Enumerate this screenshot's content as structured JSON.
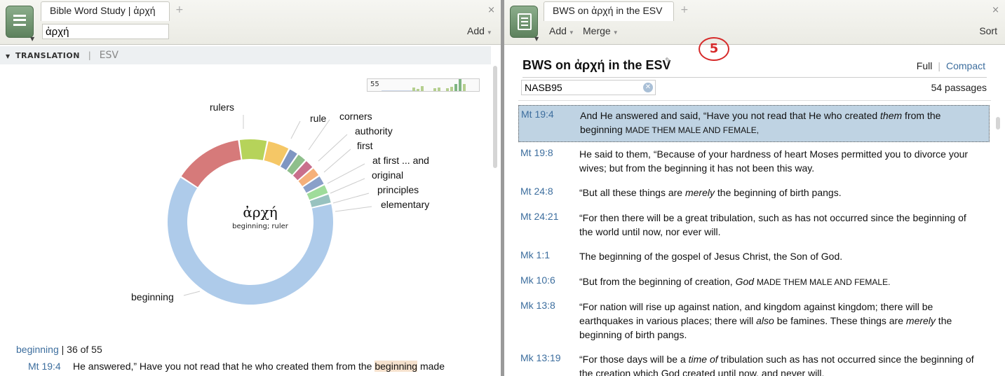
{
  "left": {
    "tab_title": "Bible Word Study | ἀρχή",
    "tab_plus": "+",
    "tab_close": "×",
    "search_value": "ἀρχή",
    "add_label": "Add",
    "section_title": "TRANSLATION",
    "section_version": "ESV",
    "histogram_label": "55",
    "lemma": "ἀρχή",
    "gloss": "beginning; ruler",
    "donut_labels": [
      "rulers",
      "rule",
      "corners",
      "authority",
      "first",
      "at first ... and",
      "original",
      "principles",
      "elementary",
      "beginning"
    ],
    "occurrence": {
      "word": "beginning",
      "count_text": "| 36 of 55"
    },
    "verse": {
      "ref": "Mt 19:4",
      "before": "He answered,” Have you not read that he who created them from the ",
      "highlight": "beginning",
      "after": " made"
    },
    "colors": {
      "beginning": "#aecbea",
      "rulers": "#d67a7a",
      "rule": "#b6d35a",
      "accent": "#3d6e9e"
    }
  },
  "right": {
    "tab_title": "BWS on ἀρχή in the ESV",
    "tab_plus": "+",
    "tab_close": "×",
    "add_label": "Add",
    "merge_label": "Merge",
    "sort_label": "Sort",
    "badge": "5",
    "doc_title": "BWS on ἀρχή in the ESV",
    "view_full": "Full",
    "view_compact": "Compact",
    "version_value": "NASB95",
    "passage_count": "54 passages",
    "rows": [
      {
        "ref": "Mt 19:4",
        "t1": "And He answered and said, “Have you not read that He who created ",
        "i1": "them",
        "t2": " from the beginning ",
        "sc": "MADE THEM MALE AND FEMALE,",
        "t3": ""
      },
      {
        "ref": "Mt 19:8",
        "t1": "He said to them, “Because of your hardness of heart Moses permitted you to divorce your wives; but from the beginning it has not been this way."
      },
      {
        "ref": "Mt 24:8",
        "t1": "“But all these things are ",
        "i1": "merely",
        "t2": " the beginning of birth pangs."
      },
      {
        "ref": "Mt 24:21",
        "t1": "“For then there will be a great tribulation, such as has not occurred since the beginning of the world until now, nor ever will."
      },
      {
        "ref": "Mk 1:1",
        "t1": "The beginning of the gospel of Jesus Christ, the Son of God."
      },
      {
        "ref": "Mk 10:6",
        "t1": "“But from the beginning of creation, ",
        "i1": "God",
        "t2": " ",
        "sc": "MADE THEM MALE AND FEMALE.",
        "t3": ""
      },
      {
        "ref": "Mk 13:8",
        "t1": "“For nation will rise up against nation, and kingdom against kingdom; there will be earthquakes in various places; there will ",
        "i1": "also",
        "t2": " be famines. These things are ",
        "i2": "merely",
        "t3": " the beginning of birth pangs."
      },
      {
        "ref": "Mk 13:19",
        "t1": "“For those days will be a ",
        "i1": "time of",
        "t2": " tribulation such as has not occurred since the beginning of the creation which God created until now, and never will."
      }
    ]
  }
}
